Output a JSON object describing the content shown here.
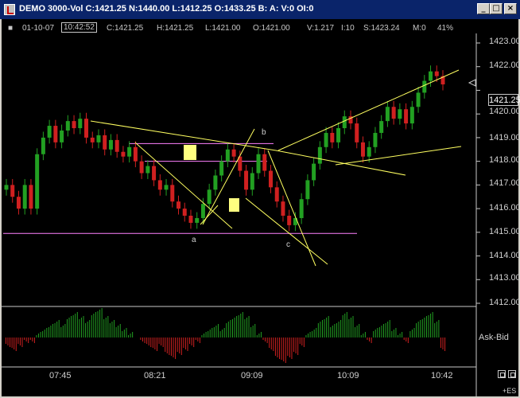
{
  "window": {
    "title": "DEMO 3000-Vol C:1421.25 N:1440.00 L:1412.25 O:1433.25 B: A: V:0 OI:0",
    "buttons": {
      "minimize": "_",
      "maximize": "□",
      "close": "×"
    }
  },
  "infobar": {
    "bullet": "■",
    "date": "01-10-07",
    "time": "10:42:52",
    "close": "C:1421.25",
    "high": "H:1421.25",
    "low": "L:1421.00",
    "open": "O:1421.00",
    "volume": "V:1.217",
    "interval": "I:10",
    "settle": "S:1423.24",
    "mode": "M:0",
    "pct": "41%"
  },
  "price_axis": [
    "1423.00",
    "1422.00",
    "1421.00",
    "1420.00",
    "1419.00",
    "1418.00",
    "1417.00",
    "1416.00",
    "1415.00",
    "1414.00",
    "1413.00",
    "1412.00"
  ],
  "current_price": "1421.25",
  "time_axis": [
    "07:45",
    "08:21",
    "09:09",
    "10:09",
    "10:42"
  ],
  "labels": {
    "a": "a",
    "b": "b",
    "c": "c"
  },
  "indicator": {
    "name": "Ask-Bid",
    "symbol": "+ES"
  },
  "colors": {
    "up": "#22a022",
    "down": "#d02020",
    "trend": "#ffff60",
    "hline": "#ff80ff",
    "box": "#ffff80"
  },
  "chart_data": {
    "type": "candlestick",
    "price_range": [
      1412,
      1423.5
    ],
    "up_color": "#22a022",
    "down_color": "#d02020",
    "price_levels": [
      1414.95,
      1418.75,
      1418.0
    ],
    "candles": [
      1417,
      1416.5,
      1416,
      1417,
      1416,
      1418.3,
      1419,
      1419.5,
      1418.8,
      1419.3,
      1419.7,
      1419.4,
      1419.8,
      1419,
      1418.8,
      1419.1,
      1418.5,
      1418.9,
      1418.4,
      1418.2,
      1418.6,
      1418,
      1417.5,
      1417.8,
      1417.2,
      1416.8,
      1417,
      1416.3,
      1416,
      1415.7,
      1415.4,
      1415.6,
      1416.2,
      1416.8,
      1417.4,
      1418,
      1418.5,
      1418.2,
      1417.6,
      1416.8,
      1417.5,
      1418.3,
      1417.6,
      1416.9,
      1416.3,
      1415.7,
      1415.3,
      1415.6,
      1416.4,
      1417.2,
      1417.9,
      1418.6,
      1419.2,
      1418.8,
      1419.4,
      1419.9,
      1419.6,
      1418.8,
      1418.2,
      1418.6,
      1419.2,
      1419.7,
      1420.3,
      1419.8,
      1420.2,
      1419.6,
      1420.3,
      1420.9,
      1421.4,
      1421.8,
      1421.6,
      1421.25
    ],
    "histogram": [
      -2,
      -3,
      -2,
      -1,
      -1,
      1,
      2,
      3,
      4,
      3,
      5,
      6,
      5,
      4,
      6,
      7,
      5,
      4,
      3,
      2,
      1,
      0,
      -1,
      -2,
      -3,
      -2,
      -4,
      -5,
      -4,
      -3,
      -2,
      -1,
      1,
      2,
      3,
      2,
      4,
      5,
      6,
      5,
      3,
      1,
      -1,
      -3,
      -5,
      -6,
      -5,
      -4,
      -2,
      1,
      2,
      4,
      5,
      3,
      4,
      6,
      5,
      3,
      1,
      -1,
      2,
      3,
      4,
      2,
      1,
      -1,
      2,
      4,
      5,
      6,
      4,
      -3
    ],
    "histogram_range": [
      -7,
      7
    ]
  }
}
